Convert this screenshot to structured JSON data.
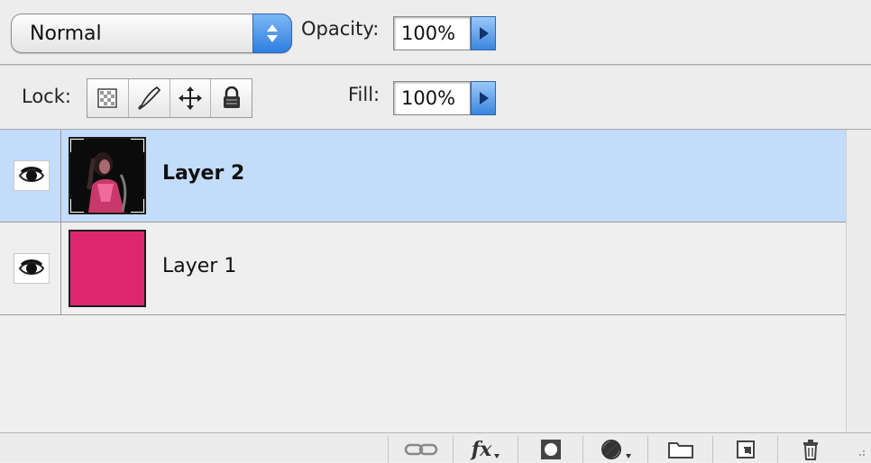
{
  "toolbar": {
    "blend_mode": "Normal",
    "opacity_label": "Opacity:",
    "opacity_value": "100%",
    "lock_label": "Lock:",
    "fill_label": "Fill:",
    "fill_value": "100%",
    "lock_icons": [
      "lock-transparency-icon",
      "lock-image-pixels-icon",
      "lock-position-icon",
      "lock-all-icon"
    ]
  },
  "layers": [
    {
      "name": "Layer 2",
      "selected": true,
      "visible": true,
      "thumbnail": "photo"
    },
    {
      "name": "Layer 1",
      "selected": false,
      "visible": true,
      "thumbnail": "solid-pink"
    }
  ],
  "footer": {
    "icons": [
      "link-layers-icon",
      "fx-icon",
      "layer-mask-icon",
      "adjustment-layer-icon",
      "folder-icon",
      "new-layer-icon",
      "trash-icon"
    ],
    "fx_label": "fx"
  },
  "colors": {
    "selection": "#c4dcfb",
    "layer1_fill": "#dd2870",
    "accent": "#3a86e0"
  }
}
